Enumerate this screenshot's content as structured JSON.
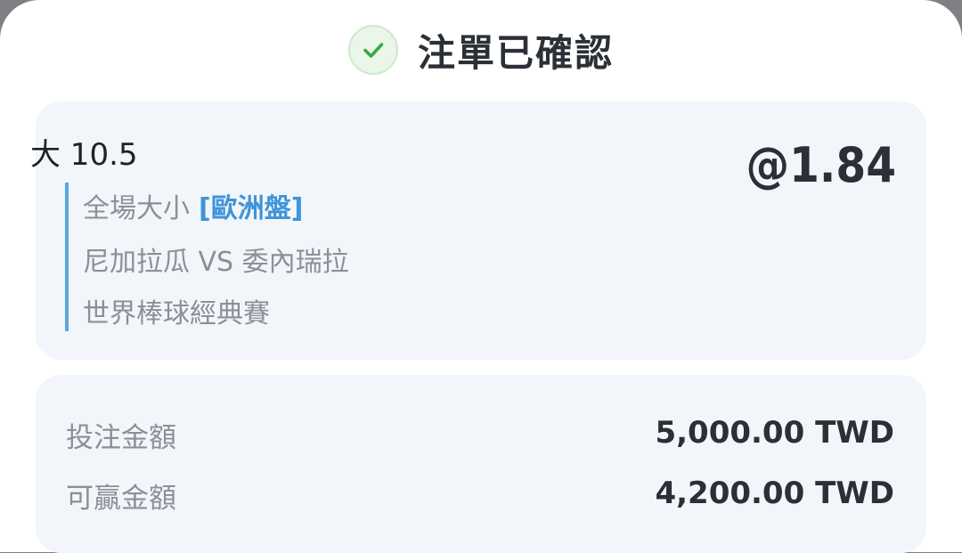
{
  "header": {
    "title": "注單已確認",
    "status_icon": "check-icon",
    "accent_color": "#3aa844"
  },
  "bet": {
    "selection": "大 10.5",
    "odds": "@1.84",
    "market": "全場大小",
    "market_tag": "[歐洲盤]",
    "match": "尼加拉瓜 VS 委內瑞拉",
    "league": "世界棒球經典賽",
    "accent_color": "#5aa6e0"
  },
  "amounts": {
    "stake_label": "投注金額",
    "stake_value": "5,000.00 TWD",
    "win_label": "可贏金額",
    "win_value": "4,200.00 TWD"
  }
}
